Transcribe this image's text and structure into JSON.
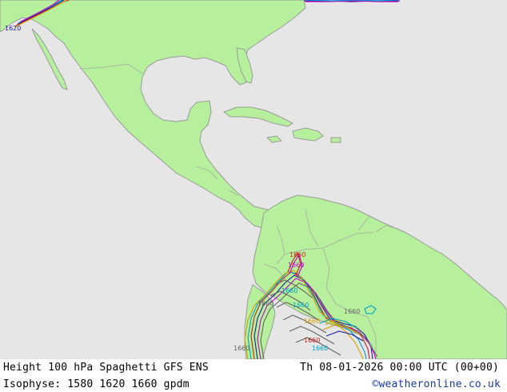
{
  "map": {
    "colors": {
      "ocean": "#e6e6e6",
      "land": "#b6f09c",
      "coast": "#9a9a9a",
      "border": "#a8a8a8"
    },
    "contour_labels": [
      {
        "text": "1620",
        "color": "#1e1e9c"
      },
      {
        "text": "1660",
        "color": "#c81e1e"
      },
      {
        "text": "1660",
        "color": "#d4a000"
      },
      {
        "text": "1660",
        "color": "#c800c8"
      },
      {
        "text": "1660",
        "color": "#00a0c8"
      },
      {
        "text": "1660",
        "color": "#00a0c8"
      },
      {
        "text": "1660",
        "color": "#646464"
      },
      {
        "text": "1660",
        "color": "#646464"
      },
      {
        "text": "1660",
        "color": "#d4a000"
      },
      {
        "text": "1660",
        "color": "#c81e1e"
      },
      {
        "text": "1660",
        "color": "#00a0c8"
      },
      {
        "text": "1660",
        "color": "#646464"
      }
    ]
  },
  "footer": {
    "title": "Height 100 hPa Spaghetti  GFS ENS",
    "valid": "Th 08-01-2026 00:00 UTC (00+00)",
    "isophyse": "Isophyse: 1580 1620 1660 gpdm",
    "credit": "©weatheronline.co.uk"
  }
}
